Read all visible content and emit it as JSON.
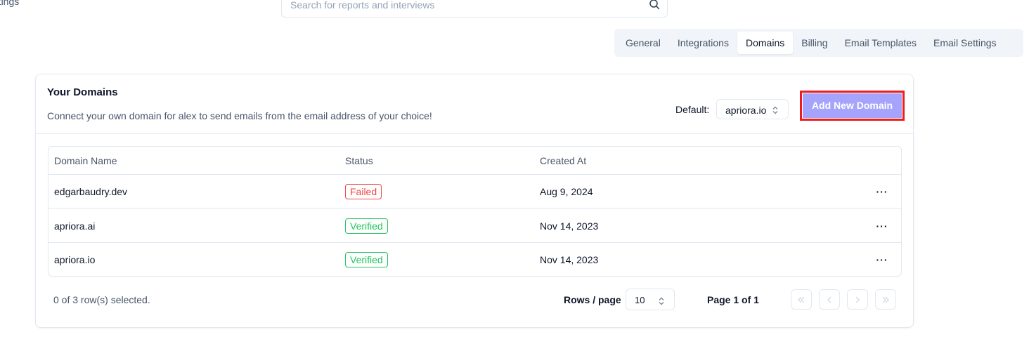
{
  "sidebar": {
    "partial_label": "ettings"
  },
  "search": {
    "placeholder": "Search for reports and interviews"
  },
  "tabs": [
    {
      "label": "General",
      "active": false
    },
    {
      "label": "Integrations",
      "active": false
    },
    {
      "label": "Domains",
      "active": true
    },
    {
      "label": "Billing",
      "active": false
    },
    {
      "label": "Email Templates",
      "active": false
    },
    {
      "label": "Email Settings",
      "active": false
    }
  ],
  "card": {
    "title": "Your Domains",
    "description": "Connect your own domain for alex to send emails from the email address of your choice!",
    "default_label": "Default:",
    "default_value": "apriora.io",
    "add_button": "Add New Domain"
  },
  "table": {
    "headers": {
      "name": "Domain Name",
      "status": "Status",
      "created": "Created At"
    },
    "rows": [
      {
        "name": "edgarbaudry.dev",
        "status": "Failed",
        "created": "Aug 9, 2024"
      },
      {
        "name": "apriora.ai",
        "status": "Verified",
        "created": "Nov 14, 2023"
      },
      {
        "name": "apriora.io",
        "status": "Verified",
        "created": "Nov 14, 2023"
      }
    ],
    "more_glyph": "···"
  },
  "pagination": {
    "selected_text": "0 of 3 row(s) selected.",
    "rows_label": "Rows / page",
    "rows_value": "10",
    "page_label": "Page 1 of 1"
  },
  "colors": {
    "accent_button": "#a5a3fb",
    "highlight_border": "#ef1c1c",
    "failed": "#ef4444",
    "verified": "#22c55e"
  }
}
